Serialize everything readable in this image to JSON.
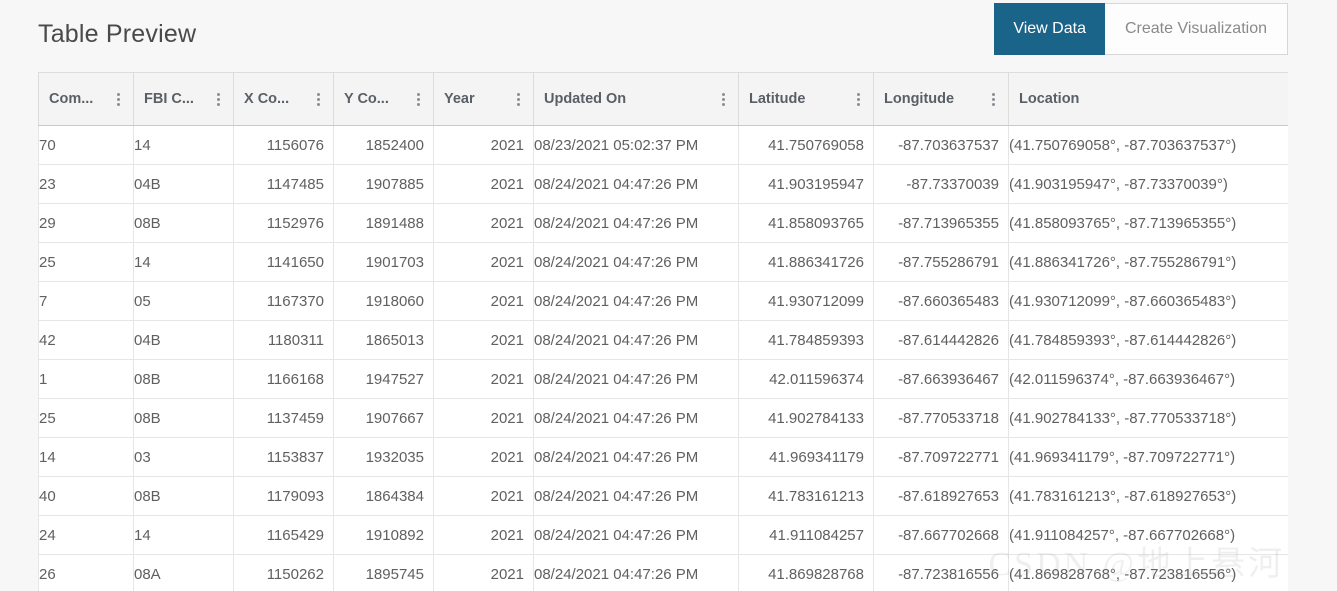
{
  "header": {
    "title": "Table Preview",
    "buttons": [
      {
        "label": "View Data",
        "active": true
      },
      {
        "label": "Create Visualization",
        "active": false
      }
    ],
    "accent_color": "#1b6489"
  },
  "table": {
    "columns": [
      {
        "label": "Com...",
        "menu": true,
        "align": "left"
      },
      {
        "label": "FBI C...",
        "menu": true,
        "align": "left"
      },
      {
        "label": "X Co...",
        "menu": true,
        "align": "right"
      },
      {
        "label": "Y Co...",
        "menu": true,
        "align": "right"
      },
      {
        "label": "Year",
        "menu": true,
        "align": "right"
      },
      {
        "label": "Updated On",
        "menu": true,
        "align": "left"
      },
      {
        "label": "Latitude",
        "menu": true,
        "align": "right"
      },
      {
        "label": "Longitude",
        "menu": true,
        "align": "right"
      },
      {
        "label": "Location",
        "menu": false,
        "align": "left"
      }
    ],
    "rows": [
      {
        "community": "70",
        "fbi_code": "14",
        "x_coordinate": "1156076",
        "y_coordinate": "1852400",
        "year": "2021",
        "updated_on": "08/23/2021 05:02:37 PM",
        "latitude": "41.750769058",
        "longitude": "-87.703637537",
        "location": "(41.750769058°, -87.703637537°)"
      },
      {
        "community": "23",
        "fbi_code": "04B",
        "x_coordinate": "1147485",
        "y_coordinate": "1907885",
        "year": "2021",
        "updated_on": "08/24/2021 04:47:26 PM",
        "latitude": "41.903195947",
        "longitude": "-87.73370039",
        "location": "(41.903195947°, -87.73370039°)"
      },
      {
        "community": "29",
        "fbi_code": "08B",
        "x_coordinate": "1152976",
        "y_coordinate": "1891488",
        "year": "2021",
        "updated_on": "08/24/2021 04:47:26 PM",
        "latitude": "41.858093765",
        "longitude": "-87.713965355",
        "location": "(41.858093765°, -87.713965355°)"
      },
      {
        "community": "25",
        "fbi_code": "14",
        "x_coordinate": "1141650",
        "y_coordinate": "1901703",
        "year": "2021",
        "updated_on": "08/24/2021 04:47:26 PM",
        "latitude": "41.886341726",
        "longitude": "-87.755286791",
        "location": "(41.886341726°, -87.755286791°)"
      },
      {
        "community": "7",
        "fbi_code": "05",
        "x_coordinate": "1167370",
        "y_coordinate": "1918060",
        "year": "2021",
        "updated_on": "08/24/2021 04:47:26 PM",
        "latitude": "41.930712099",
        "longitude": "-87.660365483",
        "location": "(41.930712099°, -87.660365483°)"
      },
      {
        "community": "42",
        "fbi_code": "04B",
        "x_coordinate": "1180311",
        "y_coordinate": "1865013",
        "year": "2021",
        "updated_on": "08/24/2021 04:47:26 PM",
        "latitude": "41.784859393",
        "longitude": "-87.614442826",
        "location": "(41.784859393°, -87.614442826°)"
      },
      {
        "community": "1",
        "fbi_code": "08B",
        "x_coordinate": "1166168",
        "y_coordinate": "1947527",
        "year": "2021",
        "updated_on": "08/24/2021 04:47:26 PM",
        "latitude": "42.011596374",
        "longitude": "-87.663936467",
        "location": "(42.011596374°, -87.663936467°)"
      },
      {
        "community": "25",
        "fbi_code": "08B",
        "x_coordinate": "1137459",
        "y_coordinate": "1907667",
        "year": "2021",
        "updated_on": "08/24/2021 04:47:26 PM",
        "latitude": "41.902784133",
        "longitude": "-87.770533718",
        "location": "(41.902784133°, -87.770533718°)"
      },
      {
        "community": "14",
        "fbi_code": "03",
        "x_coordinate": "1153837",
        "y_coordinate": "1932035",
        "year": "2021",
        "updated_on": "08/24/2021 04:47:26 PM",
        "latitude": "41.969341179",
        "longitude": "-87.709722771",
        "location": "(41.969341179°, -87.709722771°)"
      },
      {
        "community": "40",
        "fbi_code": "08B",
        "x_coordinate": "1179093",
        "y_coordinate": "1864384",
        "year": "2021",
        "updated_on": "08/24/2021 04:47:26 PM",
        "latitude": "41.783161213",
        "longitude": "-87.618927653",
        "location": "(41.783161213°, -87.618927653°)"
      },
      {
        "community": "24",
        "fbi_code": "14",
        "x_coordinate": "1165429",
        "y_coordinate": "1910892",
        "year": "2021",
        "updated_on": "08/24/2021 04:47:26 PM",
        "latitude": "41.911084257",
        "longitude": "-87.667702668",
        "location": "(41.911084257°, -87.667702668°)"
      },
      {
        "community": "26",
        "fbi_code": "08A",
        "x_coordinate": "1150262",
        "y_coordinate": "1895745",
        "year": "2021",
        "updated_on": "08/24/2021 04:47:26 PM",
        "latitude": "41.869828768",
        "longitude": "-87.723816556",
        "location": "(41.869828768°, -87.723816556°)"
      }
    ]
  },
  "watermark": {
    "text": "CSDN @地上悬河"
  }
}
